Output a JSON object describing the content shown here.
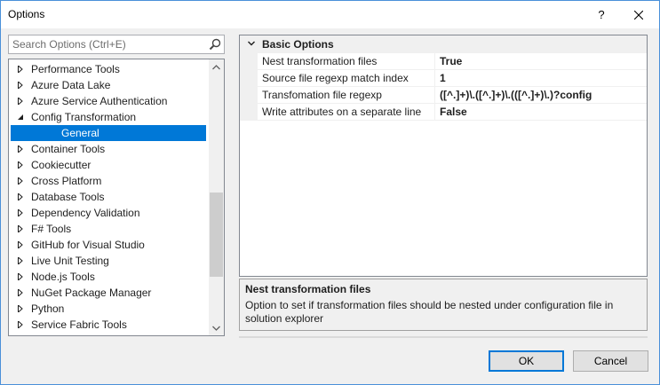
{
  "window": {
    "title": "Options",
    "help_glyph": "?",
    "close_glyph": "✕"
  },
  "search": {
    "placeholder": "Search Options (Ctrl+E)",
    "icon": "search-icon"
  },
  "tree": {
    "items": [
      {
        "label": "Performance Tools",
        "state": "collapsed"
      },
      {
        "label": "Azure Data Lake",
        "state": "collapsed"
      },
      {
        "label": "Azure Service Authentication",
        "state": "collapsed"
      },
      {
        "label": "Config Transformation",
        "state": "expanded"
      },
      {
        "label": "General",
        "state": "child-selected"
      },
      {
        "label": "Container Tools",
        "state": "collapsed"
      },
      {
        "label": "Cookiecutter",
        "state": "collapsed"
      },
      {
        "label": "Cross Platform",
        "state": "collapsed"
      },
      {
        "label": "Database Tools",
        "state": "collapsed"
      },
      {
        "label": "Dependency Validation",
        "state": "collapsed"
      },
      {
        "label": "F# Tools",
        "state": "collapsed"
      },
      {
        "label": "GitHub for Visual Studio",
        "state": "collapsed"
      },
      {
        "label": "Live Unit Testing",
        "state": "collapsed"
      },
      {
        "label": "Node.js Tools",
        "state": "collapsed"
      },
      {
        "label": "NuGet Package Manager",
        "state": "collapsed"
      },
      {
        "label": "Python",
        "state": "collapsed"
      },
      {
        "label": "Service Fabric Tools",
        "state": "collapsed"
      }
    ]
  },
  "properties": {
    "category": "Basic Options",
    "rows": [
      {
        "name": "Nest transformation files",
        "value": "True"
      },
      {
        "name": "Source file regexp match index",
        "value": "1"
      },
      {
        "name": "Transfomation file regexp",
        "value": "([^.]+)\\.([^.]+)\\.(([^.]+)\\.)?config"
      },
      {
        "name": "Write attributes on a separate line",
        "value": "False"
      }
    ]
  },
  "description": {
    "title": "Nest transformation files",
    "text": "Option to set if transformation files should be nested under configuration file in solution explorer"
  },
  "buttons": {
    "ok": "OK",
    "cancel": "Cancel"
  },
  "colors": {
    "selection": "#0078d7",
    "accent_border": "#0078d7"
  }
}
